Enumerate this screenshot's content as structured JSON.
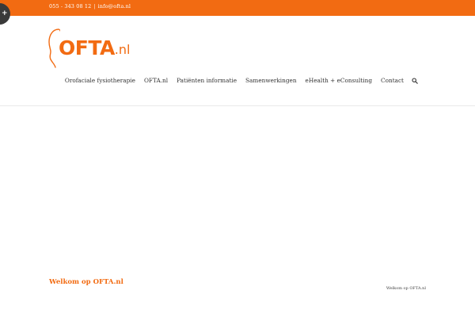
{
  "topbar": {
    "phone": "055 - 343 08 12",
    "separator": "|",
    "email": "info@ofta.nl",
    "color": "#f26b12"
  },
  "toggle": {
    "icon": "plus-icon",
    "label": "+"
  },
  "logo": {
    "main": "OFTA",
    "ext": ".nl",
    "icon": "head-profile-icon",
    "color": "#f26b12"
  },
  "nav": {
    "items": [
      {
        "label": "Orofaciale fysiotherapie"
      },
      {
        "label": "OFTA.nl"
      },
      {
        "label": "Patiënten informatie"
      },
      {
        "label": "Samenwerkingen"
      },
      {
        "label": "eHealth + eConsulting"
      },
      {
        "label": "Contact"
      }
    ],
    "search_icon": "search-icon"
  },
  "content": {
    "heading": "Welkom op OFTA.nl",
    "breadcrumb": "Welkom op OFTA.nl"
  }
}
